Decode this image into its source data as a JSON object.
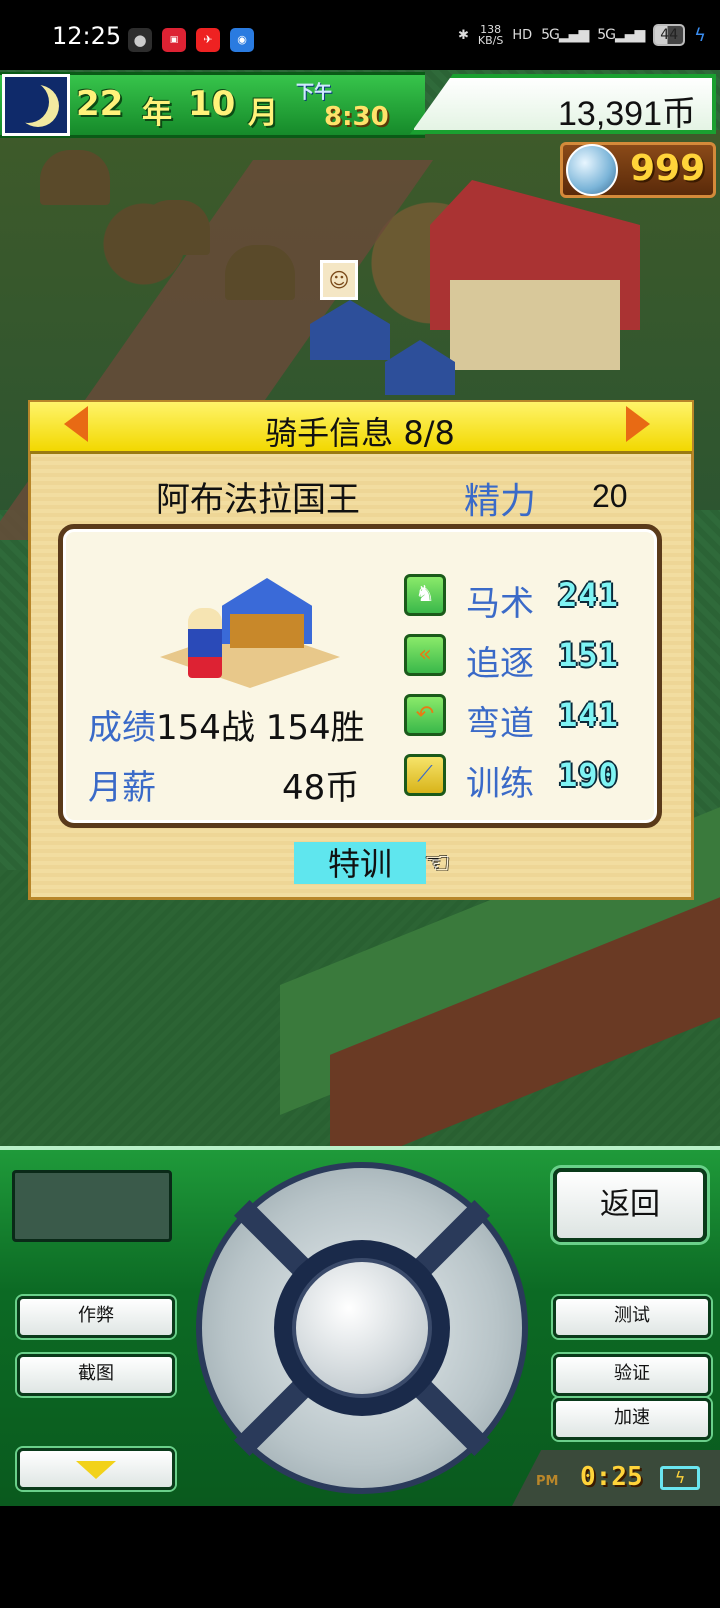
{
  "status_bar": {
    "time": "12:25",
    "app_icons": [
      "wechat-icon",
      "toutiao-icon",
      "share-icon",
      "camera-icon"
    ],
    "network_speed": "138\nKB/S",
    "hd_label": "HD",
    "signal1": "5G",
    "signal2": "5G",
    "battery": "44"
  },
  "hud": {
    "year": "22",
    "year_unit": "年",
    "month": "10",
    "month_unit": "月",
    "ampm": "下午",
    "clock": "8:30",
    "money": "13,391币",
    "gems": "999"
  },
  "panel": {
    "title": "骑手信息 8/8",
    "jockey_name": "阿布法拉国王",
    "energy_label": "精力",
    "energy_value": "20",
    "record_label": "成绩",
    "record_value": "154战 154胜",
    "salary_label": "月薪",
    "salary_value": "48币",
    "stats": [
      {
        "label": "马术",
        "value": "241",
        "icon": "horse-icon"
      },
      {
        "label": "追逐",
        "value": "151",
        "icon": "chevrons-icon"
      },
      {
        "label": "弯道",
        "value": "141",
        "icon": "curve-arrow-icon"
      },
      {
        "label": "训练",
        "value": "190",
        "icon": "whip-icon"
      }
    ],
    "train_button": "特训"
  },
  "controller": {
    "back": "返回",
    "cheat": "作弊",
    "screenshot": "截图",
    "test": "测试",
    "verify": "验证",
    "speed_up": "加速",
    "pm": "PM",
    "clock": "0:25"
  },
  "colors": {
    "hud_green": "#1aa030",
    "panel_header": "#f2d800",
    "label_blue": "#3a6ac8",
    "stat_cyan": "#7ff4f4",
    "train_button": "#5fe6ee"
  }
}
